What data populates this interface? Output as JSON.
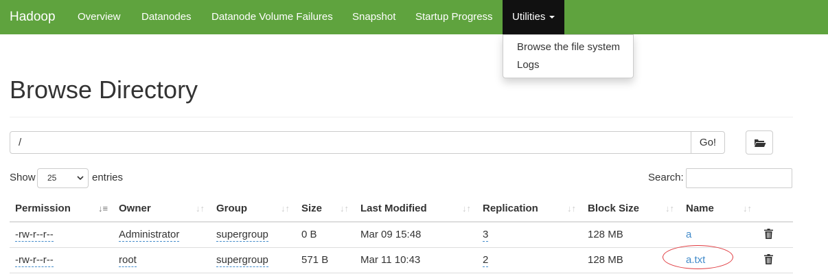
{
  "navbar": {
    "brand": "Hadoop",
    "items": [
      "Overview",
      "Datanodes",
      "Datanode Volume Failures",
      "Snapshot",
      "Startup Progress"
    ],
    "active": "Utilities"
  },
  "dropdown": {
    "items": [
      "Browse the file system",
      "Logs"
    ]
  },
  "page": {
    "title": "Browse Directory"
  },
  "path": {
    "value": "/",
    "go_label": "Go!"
  },
  "controls": {
    "show_label": "Show",
    "entries_value": "25",
    "entries_label": "entries",
    "search_label": "Search:"
  },
  "table": {
    "headers": [
      "Permission",
      "Owner",
      "Group",
      "Size",
      "Last Modified",
      "Replication",
      "Block Size",
      "Name"
    ],
    "rows": [
      {
        "permission": "-rw-r--r--",
        "owner": "Administrator",
        "group": "supergroup",
        "size": "0 B",
        "modified": "Mar 09 15:48",
        "replication": "3",
        "block_size": "128 MB",
        "name": "a"
      },
      {
        "permission": "-rw-r--r--",
        "owner": "root",
        "group": "supergroup",
        "size": "571 B",
        "modified": "Mar 11 10:43",
        "replication": "2",
        "block_size": "128 MB",
        "name": "a.txt"
      }
    ]
  },
  "icons": {
    "caret": "caret-down-icon",
    "folder": "folder-open-icon",
    "sort": "sort-icon",
    "delete": "trash-icon"
  },
  "colors": {
    "navbar": "#5fa33e",
    "active_nav": "#111111",
    "link": "#428bca",
    "annotation": "#e0393e"
  }
}
